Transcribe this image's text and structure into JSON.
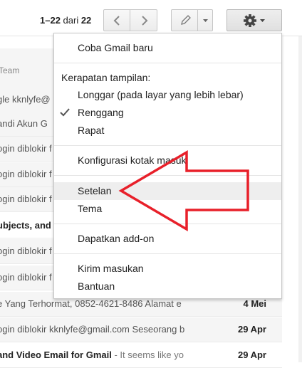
{
  "toolbar": {
    "pager_range": "1–22",
    "pager_of": " dari ",
    "pager_total": "22"
  },
  "list": {
    "column_header": "Team",
    "rows": [
      {
        "subject": "gle kknlyfe@",
        "snippet": "",
        "date": "",
        "bold": false
      },
      {
        "subject": "andi Akun G",
        "snippet": "",
        "date": "",
        "bold": false
      },
      {
        "subject": "ogin diblokir f",
        "snippet": "",
        "date": "",
        "bold": false
      },
      {
        "subject": "ogin diblokir f",
        "snippet": "",
        "date": "",
        "bold": false
      },
      {
        "subject": "ogin diblokir f",
        "snippet": "",
        "date": "",
        "bold": false
      },
      {
        "subject": "ubjects, and",
        "snippet": "",
        "date": "",
        "bold": true
      },
      {
        "subject": "ogin diblokir f",
        "snippet": "",
        "date": "",
        "bold": false
      },
      {
        "subject": "ogin diblokir f",
        "snippet": "",
        "date": "",
        "bold": false
      },
      {
        "subject": "ogin diblokir f",
        "snippet": "",
        "date": "",
        "bold": false
      },
      {
        "subject": "e Yang Terhormat, 0852-4621-8486 Alamat e",
        "snippet": "",
        "date": "4 Mei",
        "bold": false
      },
      {
        "subject": "ogin diblokir kknlyfe@gmail.com Seseorang b",
        "snippet": "",
        "date": "29 Apr",
        "bold": false
      },
      {
        "subject": "and Video Email for Gmail",
        "snippet": " - It seems like yo",
        "date": "29 Apr",
        "bold": true
      }
    ]
  },
  "menu": {
    "try_new": "Coba Gmail baru",
    "density_label": "Kerapatan tampilan:",
    "density_options": [
      "Longgar (pada layar yang lebih lebar)",
      "Renggang",
      "Rapat"
    ],
    "configure_inbox": "Konfigurasi kotak masuk",
    "settings": "Setelan",
    "themes": "Tema",
    "get_addons": "Dapatkan add-on",
    "send_feedback": "Kirim masukan",
    "help": "Bantuan"
  },
  "colors": {
    "arrow": "#e8202a",
    "highlight": "#eeeeee"
  }
}
